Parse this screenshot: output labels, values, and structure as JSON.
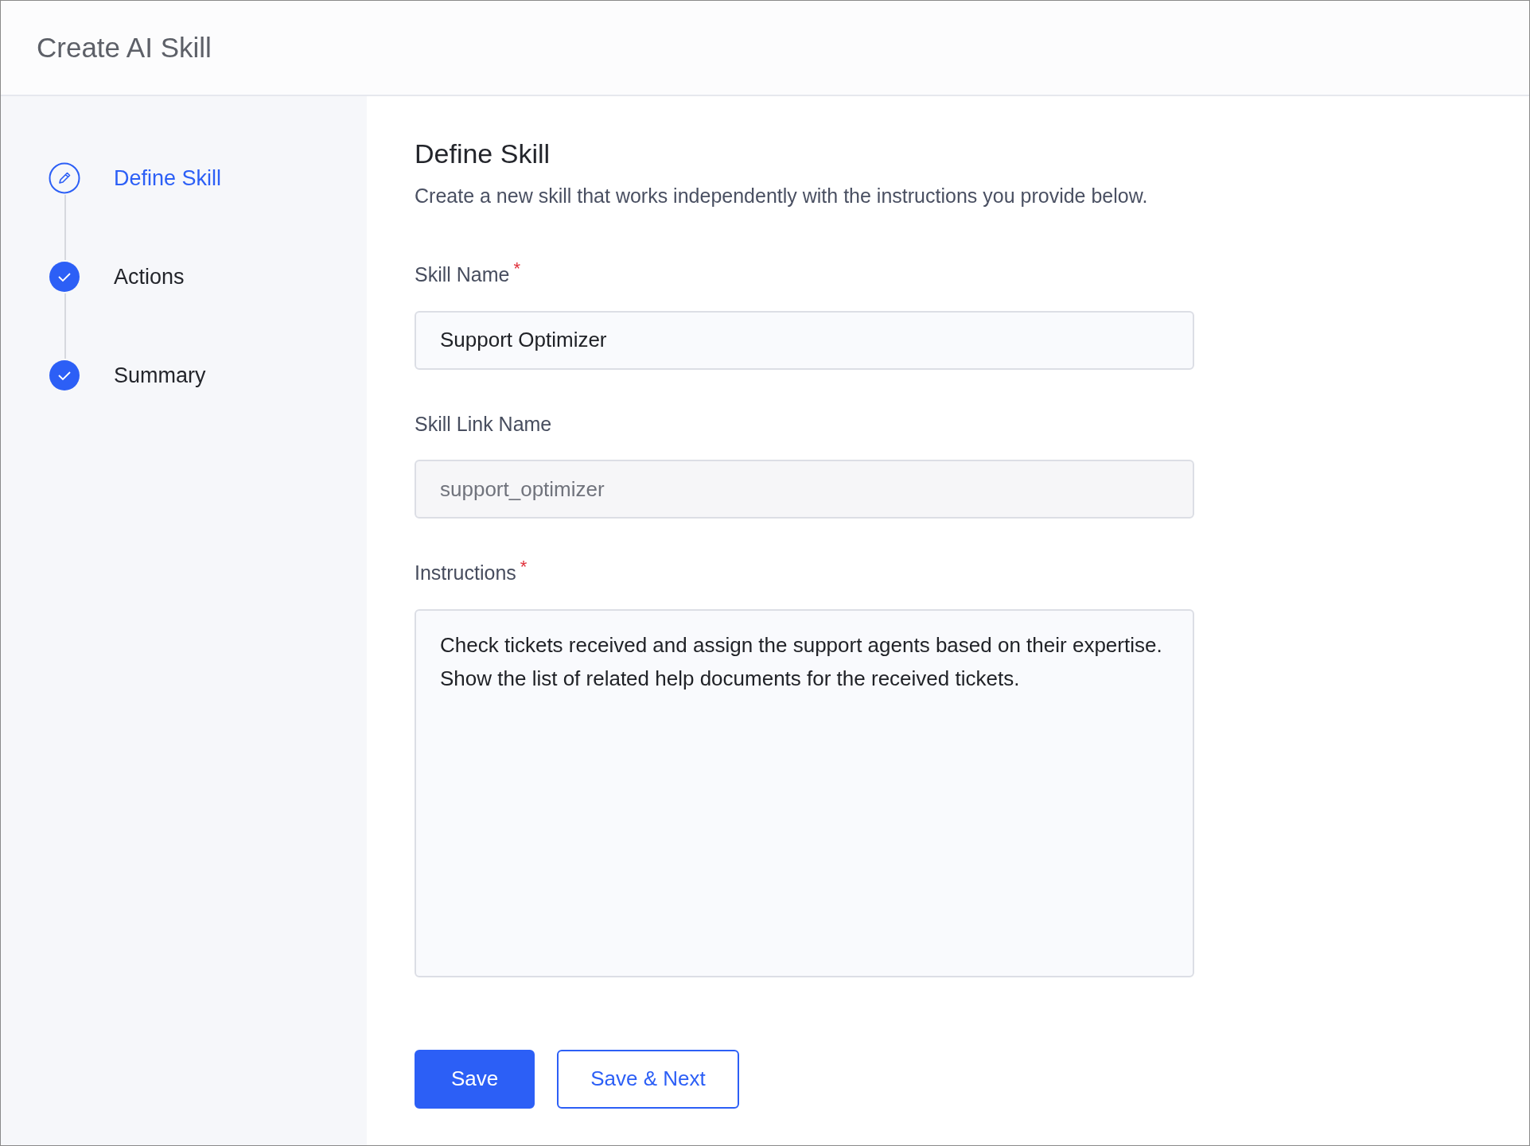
{
  "window": {
    "title": "Create AI Skill"
  },
  "steps": [
    {
      "label": "Define Skill",
      "selected": true,
      "completed": false
    },
    {
      "label": "Actions",
      "selected": false,
      "completed": true
    },
    {
      "label": "Summary",
      "selected": false,
      "completed": true
    }
  ],
  "form": {
    "title": "Define Skill",
    "description": "Create a new skill that works independently with the instructions you provide below.",
    "fields": [
      {
        "kind": "input",
        "label": "Skill Name",
        "required_mark": "*",
        "value": "Support Optimizer",
        "disabled": false
      },
      {
        "kind": "input",
        "label": "Skill Link Name",
        "value": "support_optimizer",
        "disabled": true
      },
      {
        "kind": "textarea",
        "label": "Instructions",
        "required_mark": "*",
        "value": "Check tickets received and assign the support agents based on their expertise.\nShow the list of related help documents for the received tickets.",
        "disabled": false
      }
    ]
  },
  "buttons": [
    {
      "label": "Save",
      "kind": "primary"
    },
    {
      "label": "Save & Next",
      "kind": "outline"
    }
  ]
}
